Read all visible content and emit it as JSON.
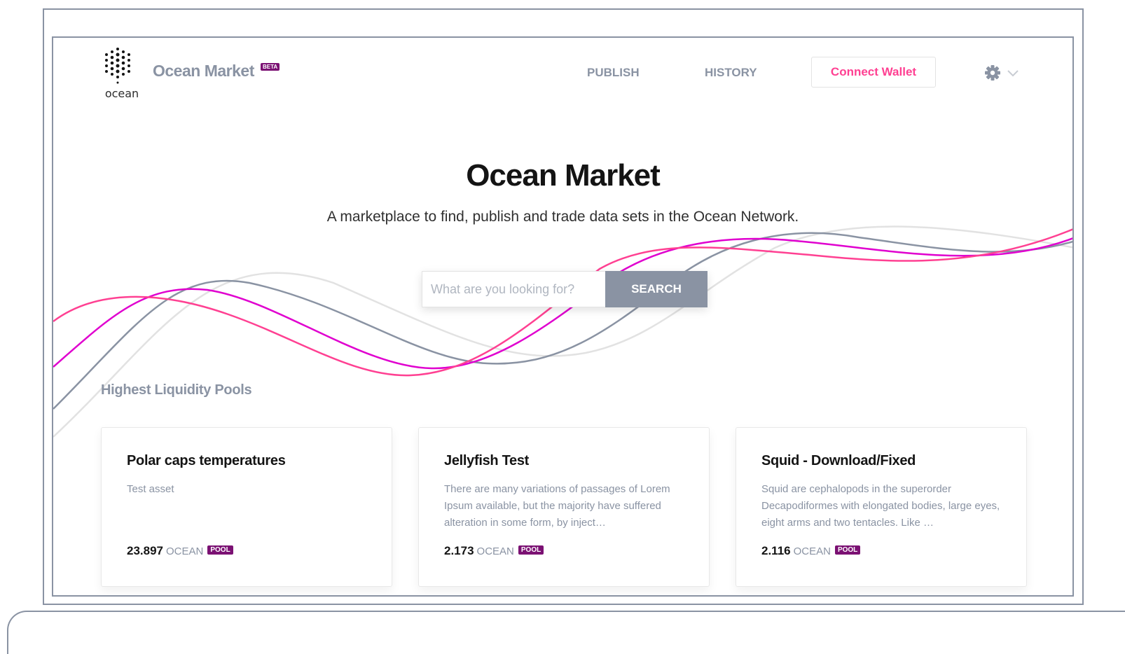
{
  "header": {
    "logo_text": "ocean",
    "brand": "Ocean Market",
    "beta_badge": "BETA",
    "nav": {
      "publish": "PUBLISH",
      "history": "HISTORY"
    },
    "connect_wallet": "Connect Wallet"
  },
  "hero": {
    "title": "Ocean Market",
    "subtitle": "A marketplace to find, publish and trade data sets in the Ocean Network."
  },
  "search": {
    "placeholder": "What are you looking for?",
    "button": "SEARCH"
  },
  "section": {
    "title": "Highest Liquidity Pools"
  },
  "cards": [
    {
      "title": "Polar caps temperatures",
      "description": "Test asset",
      "price": "23.897",
      "unit": "OCEAN",
      "badge": "POOL"
    },
    {
      "title": "Jellyfish Test",
      "description": "There are many variations of passages of Lorem Ipsum available, but the majority have suffered alteration in some form, by inject…",
      "price": "2.173",
      "unit": "OCEAN",
      "badge": "POOL"
    },
    {
      "title": "Squid - Download/Fixed",
      "description": "Squid are cephalopods in the superorder Decapodiformes with elongated bodies, large eyes, eight arms and two tentacles. Like …",
      "price": "2.116",
      "unit": "OCEAN",
      "badge": "POOL"
    }
  ],
  "colors": {
    "brand_grey": "#8a93a3",
    "accent_pink": "#ff4092",
    "accent_magenta": "#e000cf",
    "badge_purple": "#7b1173",
    "wave_light": "#e2e2e2"
  }
}
